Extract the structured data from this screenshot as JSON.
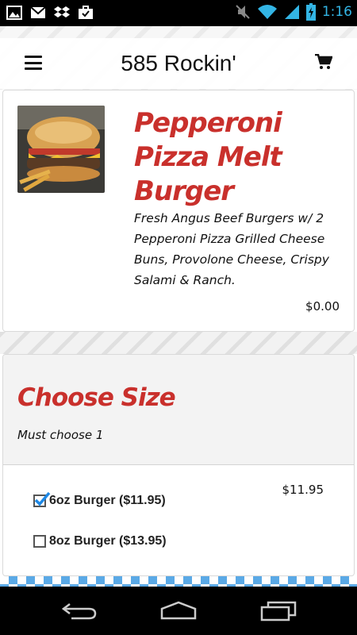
{
  "status_bar": {
    "time": "1:16",
    "left_icons": [
      "image-icon",
      "gmail-icon",
      "dropbox-icon",
      "briefcase-icon"
    ],
    "right_icons": [
      "mute-icon",
      "wifi-icon",
      "signal-icon",
      "battery-icon"
    ]
  },
  "header": {
    "title": "585 Rockin'",
    "menu_icon": "hamburger-menu-icon",
    "cart_icon": "shopping-cart-icon"
  },
  "item": {
    "name": "Pepperoni Pizza Melt Burger",
    "description": "Fresh Angus Beef Burgers w/ 2 Pepperoni Pizza Grilled Cheese Buns, Provolone Cheese, Crispy Salami & Ranch.",
    "price": "$0.00"
  },
  "options": {
    "title": "Choose Size",
    "subtitle": "Must choose 1",
    "items": [
      {
        "label": "6oz Burger ($11.95)",
        "checked": true
      },
      {
        "label": "8oz Burger ($13.95)",
        "checked": false
      }
    ],
    "selected_price": "$11.95"
  },
  "colors": {
    "accent_red": "#c9302c",
    "status_blue": "#33b5e5",
    "check_blue": "#1e88e5"
  },
  "nav_bar": {
    "icons": [
      "back-icon",
      "home-icon",
      "recent-apps-icon"
    ]
  }
}
